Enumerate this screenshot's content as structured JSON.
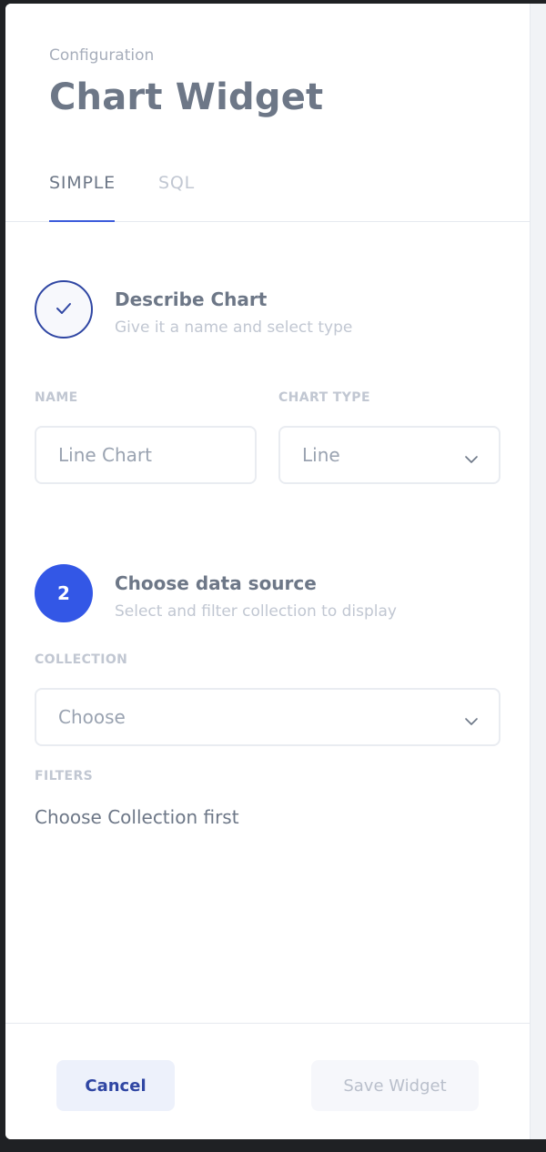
{
  "header": {
    "eyebrow": "Configuration",
    "title": "Chart Widget"
  },
  "tabs": [
    {
      "label": "SIMPLE",
      "active": true
    },
    {
      "label": "SQL",
      "active": false
    }
  ],
  "steps": [
    {
      "indicator": "check-icon",
      "title": "Describe Chart",
      "subtitle": "Give it a name and select type"
    },
    {
      "indicator": "2",
      "title": "Choose data source",
      "subtitle": "Select and filter collection to display"
    }
  ],
  "form": {
    "name": {
      "label": "NAME",
      "placeholder": "Line Chart"
    },
    "chart_type": {
      "label": "CHART TYPE",
      "value": "Line"
    },
    "collection": {
      "label": "COLLECTION",
      "value": "Choose"
    },
    "filters": {
      "label": "FILTERS",
      "message": "Choose Collection first"
    }
  },
  "footer": {
    "cancel_label": "Cancel",
    "save_label": "Save Widget"
  },
  "colors": {
    "accent": "#3357e6",
    "accent_dark": "#2f46a3",
    "text": "#6d7787",
    "muted": "#c1c7d2",
    "border": "#e9ecf1"
  }
}
